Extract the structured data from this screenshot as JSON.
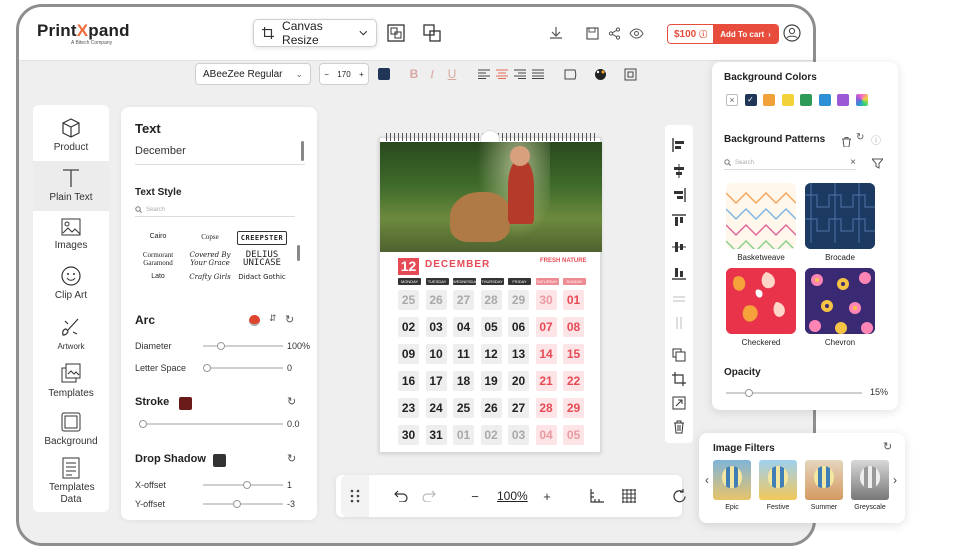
{
  "app": {
    "logo_text_a": "Print",
    "logo_text_x": "X",
    "logo_text_b": "pand",
    "logo_sub": "A Bitech Company"
  },
  "toolbar": {
    "canvas_resize_label": "Canvas Resize",
    "price": "$100",
    "add_to_cart": "Add To cart"
  },
  "format": {
    "font_name": "ABeeZee Regular",
    "font_size": "170",
    "size_minus": "−",
    "size_plus": "+",
    "text_color": "#1f3657"
  },
  "nav": {
    "items": [
      {
        "label": "Product",
        "icon": "box-icon"
      },
      {
        "label": "Plain Text",
        "icon": "text-icon"
      },
      {
        "label": "Images",
        "icon": "image-icon"
      },
      {
        "label": "Clip Art",
        "icon": "smiley-icon"
      },
      {
        "label": "Artwork",
        "icon": "brush-icon"
      },
      {
        "label": "Templates",
        "icon": "templates-icon"
      },
      {
        "label": "Background",
        "icon": "background-icon"
      },
      {
        "label": "Templates Data",
        "icon": "templates-data-icon"
      }
    ]
  },
  "text_panel": {
    "title": "Text",
    "value": "December",
    "text_style_title": "Text Style",
    "search_placeholder": "Search",
    "fonts": [
      "Cairo",
      "Copse",
      "CREEPSTER",
      "Cormorant Garamond",
      "Covered By Your Grace",
      "DELIUS UNICASE",
      "Lato",
      "Crafty Girls",
      "Didact Gothic"
    ],
    "arc_title": "Arc",
    "diameter_label": "Diameter",
    "diameter_value": "100%",
    "diameter_level": 0.2,
    "letter_space_label": "Letter Space",
    "letter_space_value": "0",
    "letter_space_level": 0.0,
    "stroke_title": "Stroke",
    "stroke_color": "#6b1a1a",
    "stroke_value": "0.0",
    "stroke_level": 0.0,
    "shadow_title": "Drop Shadow",
    "shadow_color": "#333333",
    "x_offset_label": "X-offset",
    "x_offset_value": "1",
    "x_offset_level": 0.55,
    "y_offset_label": "Y-offset",
    "y_offset_value": "-3",
    "y_offset_level": 0.42
  },
  "calendar": {
    "date": "12",
    "month": "DECEMBER",
    "brand": "FRESH NATURE",
    "weekdays": [
      "MONDAY",
      "TUESDAY",
      "WEDNESDAY",
      "THURSDAY",
      "FRIDAY",
      "SATURDAY",
      "SUNDAY"
    ],
    "weeks": [
      [
        "25",
        "26",
        "27",
        "28",
        "29",
        "30",
        "01"
      ],
      [
        "02",
        "03",
        "04",
        "05",
        "06",
        "07",
        "08"
      ],
      [
        "09",
        "10",
        "11",
        "12",
        "13",
        "14",
        "15"
      ],
      [
        "16",
        "17",
        "18",
        "19",
        "20",
        "21",
        "22"
      ],
      [
        "23",
        "24",
        "25",
        "26",
        "27",
        "28",
        "29"
      ],
      [
        "30",
        "31",
        "01",
        "02",
        "03",
        "04",
        "05"
      ]
    ]
  },
  "bottom": {
    "zoom": "100%"
  },
  "bg_panel": {
    "colors_title": "Background Colors",
    "colors": [
      "#ffffff",
      "#1f3657",
      "#f0a13a",
      "#f2d23a",
      "#2e9a58",
      "#2f8fd6",
      "#9b59d6",
      "#ff6ec7"
    ],
    "patterns_title": "Background Patterns",
    "search_placeholder": "Search",
    "patterns": [
      {
        "label": "Basketweave"
      },
      {
        "label": "Brocade"
      },
      {
        "label": "Checkered"
      },
      {
        "label": "Chevron"
      }
    ],
    "opacity_title": "Opacity",
    "opacity_value": "15%",
    "opacity_level": 0.15
  },
  "filters": {
    "title": "Image Filters",
    "items": [
      {
        "label": "Epic"
      },
      {
        "label": "Festive"
      },
      {
        "label": "Summer"
      },
      {
        "label": "Greyscale"
      }
    ]
  }
}
